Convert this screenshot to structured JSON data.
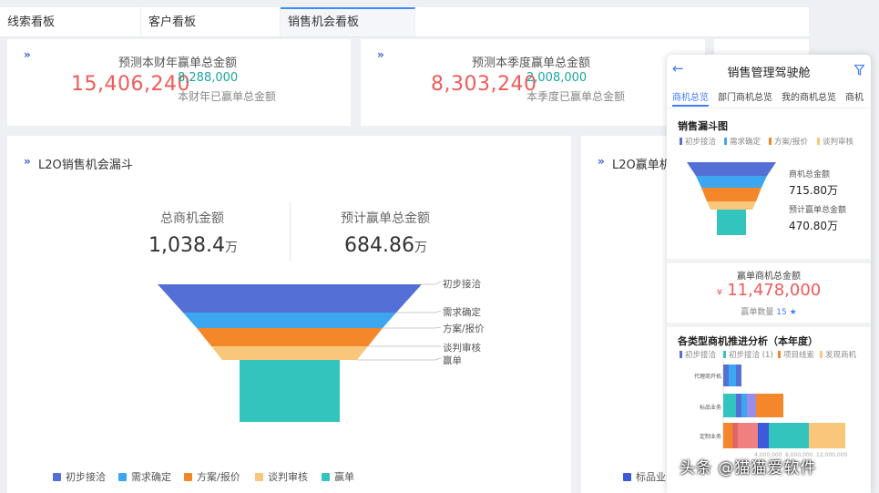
{
  "tabs": [
    {
      "label": "线索看板"
    },
    {
      "label": "客户看板"
    },
    {
      "label": "销售机会看板",
      "active": true
    }
  ],
  "kpi1": {
    "title": "预测本财年赢单总金额",
    "big": "15,406,240",
    "small": "8,288,000",
    "caption": "本财年已赢单总金额"
  },
  "kpi2": {
    "title": "预测本季度赢单总金额",
    "big": "8,303,240",
    "small": "2,008,000",
    "caption": "本季度已赢单总金额"
  },
  "funnel": {
    "title": "L2O销售机会漏斗",
    "total_label": "总商机金额",
    "total_value": "1,038.4",
    "total_unit": "万",
    "forecast_label": "预计赢单总金额",
    "forecast_value": "684.86",
    "forecast_unit": "万",
    "stages": [
      "初步接洽",
      "需求确定",
      "方案/报价",
      "谈判审核",
      "赢单"
    ],
    "colors": [
      "#5470d6",
      "#3ca6f0",
      "#f5872b",
      "#f8c77b",
      "#33c5bd"
    ],
    "legend": [
      "初步接洽",
      "需求确定",
      "方案/报价",
      "谈判审核",
      "赢单"
    ]
  },
  "right_panel": {
    "title": "L2O赢单机",
    "legend_item": "标品业务"
  },
  "mobile": {
    "back_icon": "arrow-left",
    "title": "销售管理驾驶舱",
    "filter_icon": "funnel-filter",
    "tabs": [
      "商机总览",
      "部门商机总览",
      "我的商机总览",
      "商机"
    ],
    "funnel_title": "销售漏斗图",
    "funnel_legend": [
      "初步接洽",
      "需求确定",
      "方案/报价",
      "谈判审核"
    ],
    "total_label": "商机总金额",
    "total_value": "715.80万",
    "forecast_label": "预计赢单总金额",
    "forecast_value": "470.80万",
    "won_title": "赢单商机总金额",
    "won_currency": "¥",
    "won_value": "11,478,000",
    "won_count_label": "赢单数量",
    "won_count": "15",
    "analysis_title": "各类型商机推进分析（本年度）",
    "analysis_legend": [
      "初步接洽",
      "初步接洽 (1)",
      "项目线索",
      "发现商机"
    ],
    "analysis_categories": [
      "代理商开拓",
      "标品业务",
      "定制业务"
    ],
    "axis_ticks": [
      "4,000,000",
      "8,000,000",
      "12,000,000"
    ]
  },
  "watermark": "头条 @猫猫爱软件"
}
